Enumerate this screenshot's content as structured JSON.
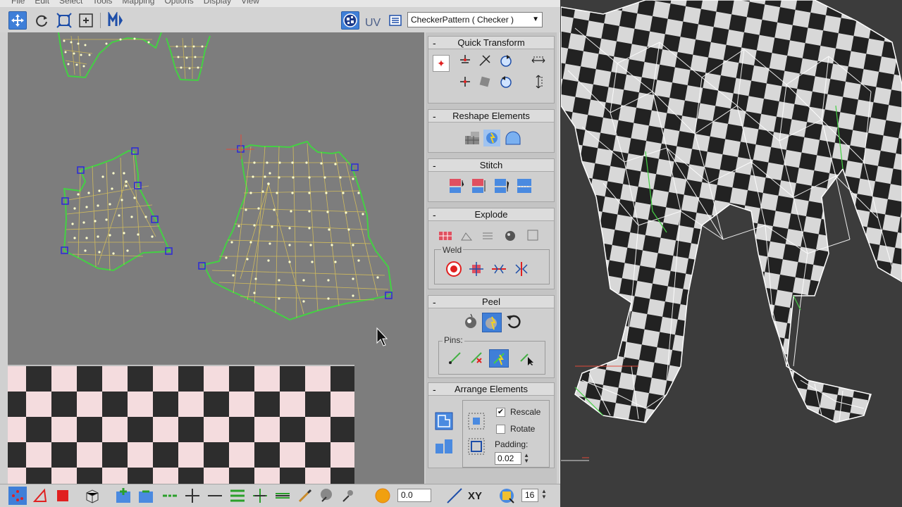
{
  "menu": [
    "File",
    "Edit",
    "Select",
    "Tools",
    "Mapping",
    "Options",
    "Display",
    "View"
  ],
  "toolbar": {
    "uv_label": "UV",
    "texture_select": "CheckerPattern  ( Checker )"
  },
  "rollouts": {
    "quick_transform": "Quick Transform",
    "reshape_elements": "Reshape Elements",
    "stitch": "Stitch",
    "explode": "Explode",
    "weld": "Weld",
    "peel": "Peel",
    "pins": "Pins:",
    "arrange_elements": "Arrange Elements",
    "rescale": "Rescale",
    "rescale_checked": true,
    "rotate": "Rotate",
    "rotate_checked": false,
    "padding_label": "Padding:",
    "padding_value": "0.02"
  },
  "bottom": {
    "soft_value": "0.0",
    "xy_label": "XY",
    "grid_value": "16"
  },
  "colors": {
    "accent": "#3f7fd8",
    "uv_edge_selected": "#44d044",
    "uv_edge": "#d8c15a",
    "vertex": "#ffffcc",
    "pin": "#2b2bd8",
    "checker_light": "#f4dcde",
    "checker_dark": "#2d2d2d"
  }
}
